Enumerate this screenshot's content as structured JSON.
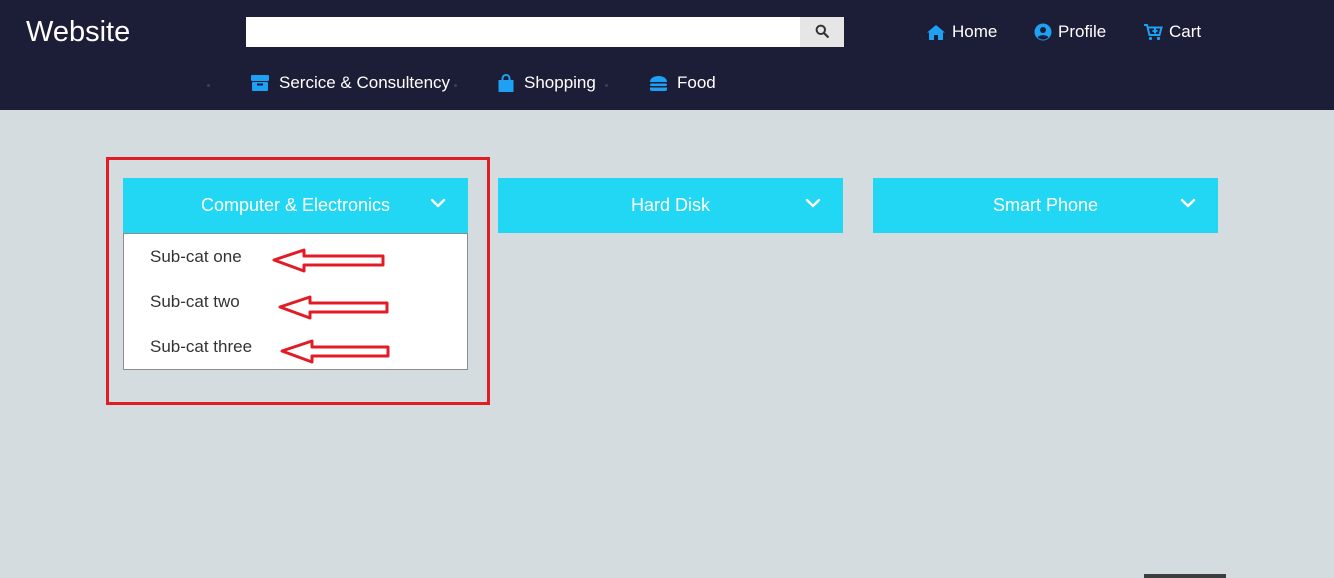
{
  "brand": {
    "name": "Website"
  },
  "search": {
    "placeholder": "",
    "value": "",
    "button_icon": "search-icon"
  },
  "top_nav": [
    {
      "label": "Home",
      "icon": "home-icon"
    },
    {
      "label": "Profile",
      "icon": "user-circle-icon"
    },
    {
      "label": "Cart",
      "icon": "cart-plus-icon"
    }
  ],
  "categories": [
    {
      "label": "Sercice & Consultency",
      "icon": "box-icon"
    },
    {
      "label": "Shopping",
      "icon": "shopping-bag-icon"
    },
    {
      "label": "Food",
      "icon": "burger-icon"
    }
  ],
  "dropdowns": [
    {
      "label": "Computer & Electronics",
      "expanded": true,
      "items": [
        "Sub-cat one",
        "Sub-cat two",
        "Sub-cat three"
      ]
    },
    {
      "label": "Hard Disk",
      "expanded": false
    },
    {
      "label": "Smart Phone",
      "expanded": false
    }
  ],
  "colors": {
    "navbar_bg": "#1c1d36",
    "page_bg": "#d5dce0",
    "accent": "#22d7f3",
    "icon_blue": "#1ea1f2",
    "annotation_red": "#e11c24"
  }
}
